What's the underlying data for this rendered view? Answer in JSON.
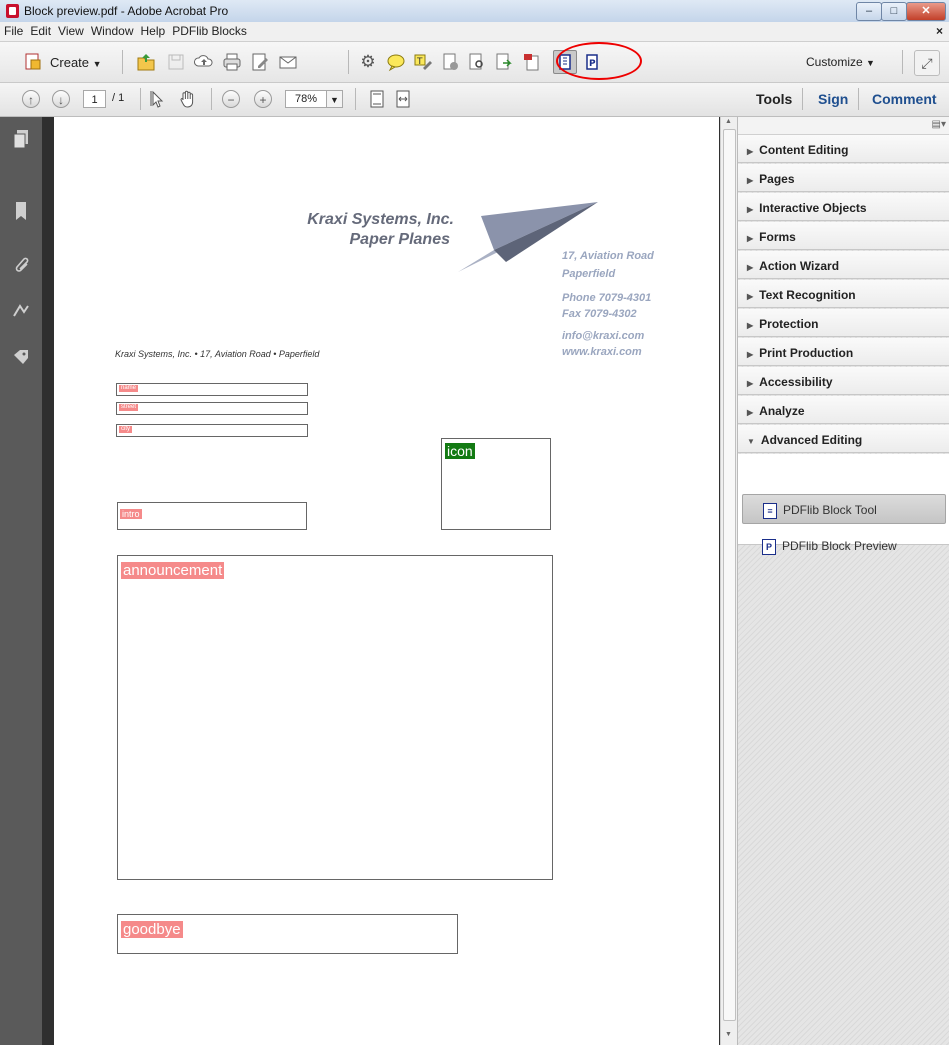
{
  "window": {
    "title": "Block preview.pdf - Adobe Acrobat Pro",
    "min": "–",
    "max": "□",
    "close": "✕"
  },
  "menu": {
    "items": [
      "File",
      "Edit",
      "View",
      "Window",
      "Help",
      "PDFlib Blocks"
    ],
    "close": "×"
  },
  "toolbar": {
    "create_label": "Create",
    "customize_label": "Customize"
  },
  "nav": {
    "page_current": "1",
    "page_total": "/ 1",
    "zoom": "78%"
  },
  "tabs": {
    "tools": "Tools",
    "sign": "Sign",
    "comment": "Comment"
  },
  "document": {
    "company_name": "Kraxi Systems, Inc.",
    "company_tagline": "Paper Planes",
    "address_line1": "17, Aviation Road",
    "address_line2": "Paperfield",
    "phone": "Phone 7079-4301",
    "fax": "Fax 7079-4302",
    "email": "info@kraxi.com",
    "web": "www.kraxi.com",
    "sender_line": "Kraxi Systems, Inc. • 17, Aviation Road • Paperfield",
    "blocks": {
      "name": "name",
      "street": "street",
      "city": "city",
      "icon": "icon",
      "intro": "intro",
      "announcement": "announcement",
      "goodbye": "goodbye"
    }
  },
  "right_panel": {
    "sections": [
      "Content Editing",
      "Pages",
      "Interactive Objects",
      "Forms",
      "Action Wizard",
      "Text Recognition",
      "Protection",
      "Print Production",
      "Accessibility",
      "Analyze",
      "Advanced Editing"
    ],
    "tools": [
      "PDFlib Block Tool",
      "PDFlib Block Preview"
    ]
  },
  "colors": {
    "block_label_bg": "#f58a8a",
    "icon_label_bg": "#137a13",
    "annotation": "#e00000"
  }
}
